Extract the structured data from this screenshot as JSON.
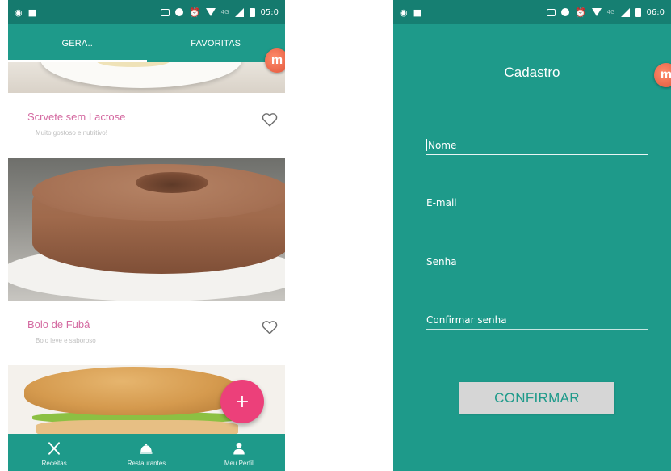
{
  "left_screen": {
    "status_bar": {
      "time": "05:0"
    },
    "tabs": [
      {
        "label": "GERA..",
        "selected": true
      },
      {
        "label": "FAVORITAS",
        "selected": false
      }
    ],
    "recipes": [
      {
        "title": "Scrvete sem Lactose",
        "description": "Muito gostoso e nutritivo!",
        "favorited": false
      },
      {
        "title": "Bolo de Fubá",
        "description": "Bolo leve e saboroso",
        "favorited": false
      }
    ],
    "fab_label": "+",
    "bottom_nav": [
      {
        "label": "Receitas",
        "icon": "utensils-icon"
      },
      {
        "label": "Restaurantes",
        "icon": "cloche-icon"
      },
      {
        "label": "Meu Perfil",
        "icon": "person-icon"
      }
    ]
  },
  "right_screen": {
    "status_bar": {
      "time": "06:0"
    },
    "title": "Cadastro",
    "form": {
      "name_label": "Nome",
      "email_label": "E-mail",
      "password_label": "Senha",
      "confirm_password_label": "Confirmar senha",
      "confirm_button": "CONFIRMAR"
    }
  },
  "colors": {
    "primary": "#1e9a8a",
    "status_bar": "#157a6e",
    "accent_pink": "#ec407a",
    "recipe_title": "#d46aa1",
    "button_gray": "#d6d6d6"
  }
}
